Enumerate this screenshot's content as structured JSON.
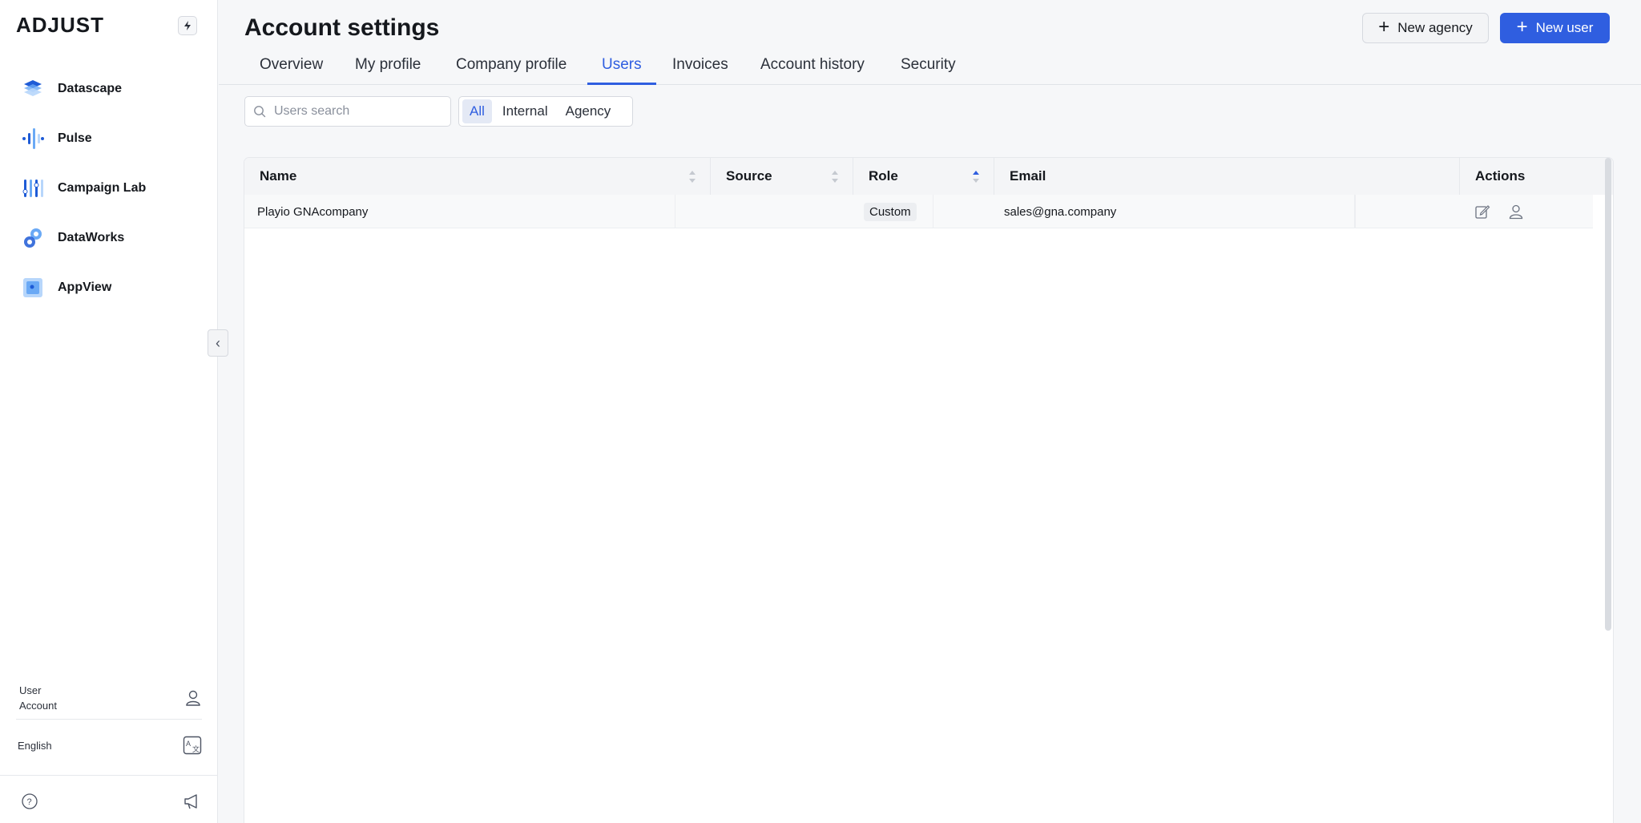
{
  "app": {
    "logo_text": "ADJUST",
    "bolt_icon": "bolt-icon"
  },
  "sidebar": {
    "items": [
      {
        "label": "Datascape",
        "icon": "datascape-icon"
      },
      {
        "label": "Pulse",
        "icon": "pulse-icon"
      },
      {
        "label": "Campaign Lab",
        "icon": "campaign-lab-icon"
      },
      {
        "label": "DataWorks",
        "icon": "dataworks-icon"
      },
      {
        "label": "AppView",
        "icon": "appview-icon"
      }
    ],
    "collapse_glyph": "‹",
    "user_line1": "User",
    "user_line2": "Account",
    "language": "English"
  },
  "header": {
    "title": "Account settings",
    "new_agency_label": "New agency",
    "new_user_label": "New user"
  },
  "tabs": [
    {
      "label": "Overview"
    },
    {
      "label": "My profile"
    },
    {
      "label": "Company profile"
    },
    {
      "label": "Users",
      "active": true
    },
    {
      "label": "Invoices"
    },
    {
      "label": "Account history"
    },
    {
      "label": "Security"
    }
  ],
  "filters": {
    "search_placeholder": "Users search",
    "search_value": "",
    "segments": [
      {
        "label": "All",
        "active": true
      },
      {
        "label": "Internal"
      },
      {
        "label": "Agency"
      }
    ]
  },
  "table": {
    "columns": [
      {
        "label": "Name",
        "sort": "none"
      },
      {
        "label": "Source",
        "sort": "none"
      },
      {
        "label": "Role",
        "sort": "asc"
      },
      {
        "label": "Email",
        "sort": null
      },
      {
        "label": "Actions",
        "sort": null
      }
    ],
    "rows": [
      {
        "name": "Playio GNAcompany",
        "source": "",
        "role": "Custom",
        "email": "sales@gna.company"
      }
    ]
  },
  "colors": {
    "accent": "#2f5ee0",
    "background": "#f6f7f9",
    "text": "#15181d"
  }
}
